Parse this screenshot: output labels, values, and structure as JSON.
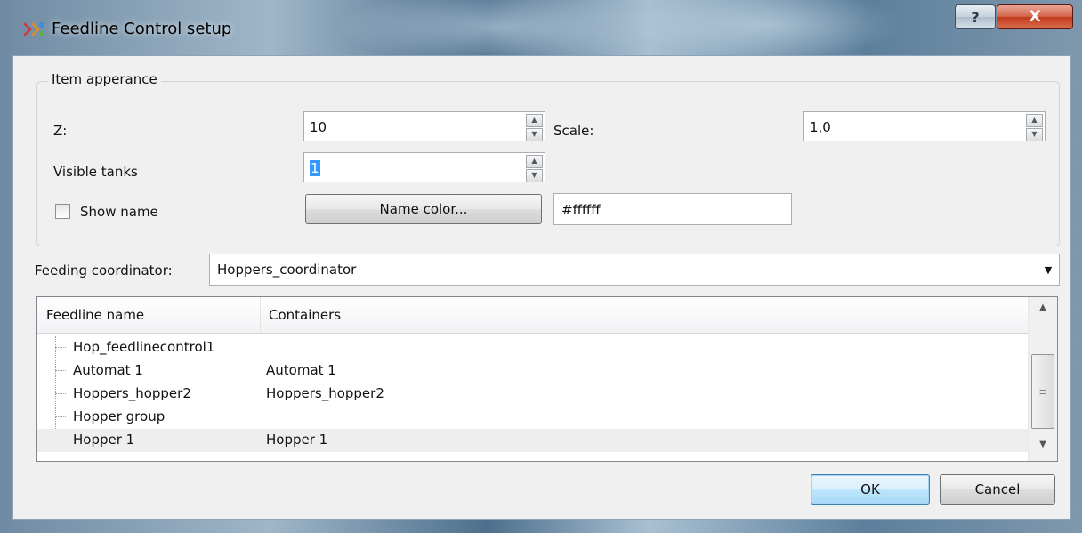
{
  "window": {
    "title": "Feedline Control setup",
    "help_glyph": "?",
    "close_glyph": "X"
  },
  "appearance": {
    "group_title": "Item apperance",
    "z_label": "Z:",
    "z_value": "10",
    "scale_label": "Scale:",
    "scale_value": "1,0",
    "visible_tanks_label": "Visible tanks",
    "visible_tanks_value": "1",
    "show_name_label": "Show name",
    "show_name_checked": false,
    "name_color_button": "Name color...",
    "name_color_value": "#ffffff"
  },
  "coordinator": {
    "label": "Feeding coordinator:",
    "value": "Hoppers_coordinator"
  },
  "tree": {
    "columns": [
      "Feedline name",
      "Containers"
    ],
    "rows": [
      {
        "name": "Hop_feedlinecontrol1",
        "containers": ""
      },
      {
        "name": "Automat 1",
        "containers": "Automat 1"
      },
      {
        "name": "Hoppers_hopper2",
        "containers": "Hoppers_hopper2"
      },
      {
        "name": "Hopper group",
        "containers": ""
      },
      {
        "name": "Hopper 1",
        "containers": "Hopper 1"
      }
    ],
    "selected_row": 4
  },
  "buttons": {
    "ok": "OK",
    "cancel": "Cancel"
  },
  "icons": [
    "app-icon",
    "spin-up-icon",
    "spin-down-icon",
    "dropdown-arrow-icon",
    "scroll-up-icon",
    "scroll-down-icon",
    "scroll-grip-icon"
  ]
}
